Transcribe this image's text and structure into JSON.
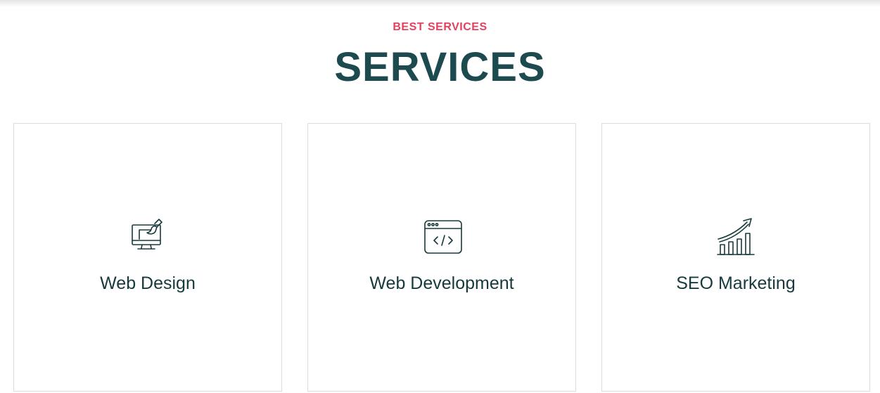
{
  "section": {
    "eyebrow": "BEST SERVICES",
    "heading": "SERVICES"
  },
  "services": [
    {
      "title": "Web Design",
      "icon": "monitor-brush-icon"
    },
    {
      "title": "Web Development",
      "icon": "browser-code-icon"
    },
    {
      "title": "SEO Marketing",
      "icon": "growth-chart-icon"
    }
  ],
  "colors": {
    "accent": "#e5405e",
    "heading": "#1d4a4e",
    "text": "#163a3c",
    "border": "#dcdcdc"
  }
}
